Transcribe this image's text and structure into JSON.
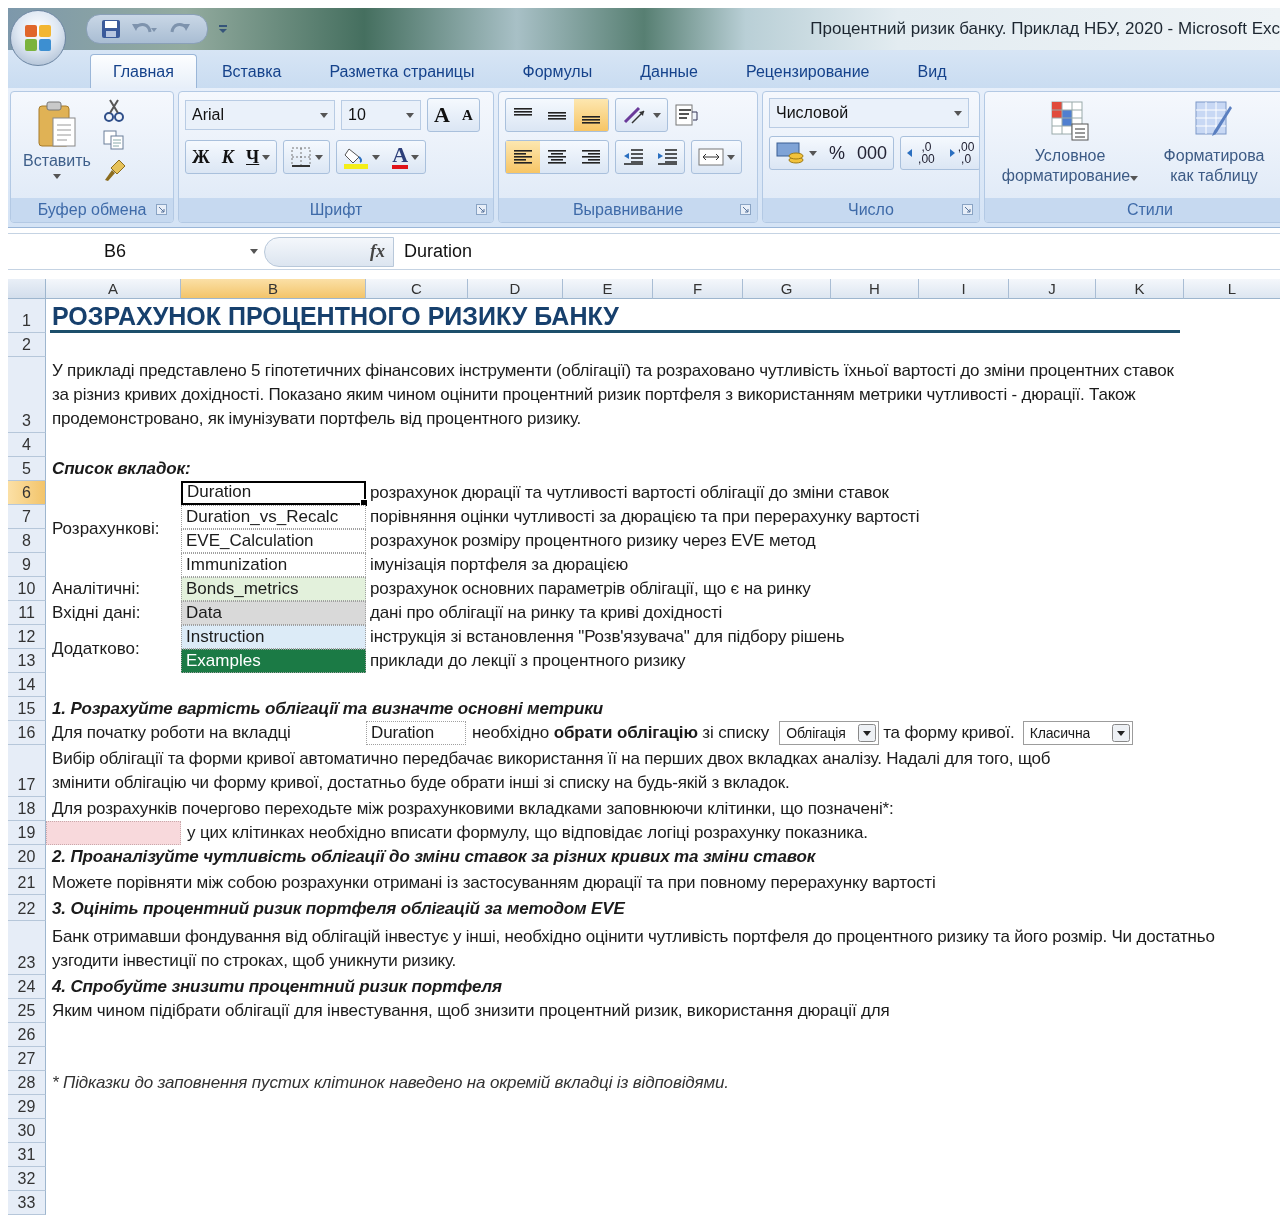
{
  "window": {
    "title": "Процентний ризик банку. Приклад НБУ, 2020 - Microsoft Exc"
  },
  "ribbon_tabs": [
    {
      "label": "Главная",
      "selected": true
    },
    {
      "label": "Вставка",
      "selected": false
    },
    {
      "label": "Разметка страницы",
      "selected": false
    },
    {
      "label": "Формулы",
      "selected": false
    },
    {
      "label": "Данные",
      "selected": false
    },
    {
      "label": "Рецензирование",
      "selected": false
    },
    {
      "label": "Вид",
      "selected": false
    }
  ],
  "ribbon": {
    "clipboard": {
      "paste": "Вставить",
      "group": "Буфер обмена"
    },
    "font": {
      "name": "Arial",
      "size": "10",
      "grow": "A",
      "shrink": "A",
      "bold": "Ж",
      "italic": "К",
      "underline": "Ч",
      "color_button": "A",
      "group": "Шрифт"
    },
    "alignment": {
      "vertical": [
        {
          "selected": false
        },
        {
          "selected": false
        },
        {
          "selected": true
        }
      ],
      "horizontal": [
        {
          "selected": true
        },
        {
          "selected": false
        },
        {
          "selected": false
        }
      ],
      "group": "Выравнивание"
    },
    "number": {
      "format": "Числовой",
      "percent": "%",
      "thousands": "000",
      "decimals": [
        {
          "top": ",0",
          "bottom": ",00"
        },
        {
          "top": ",00",
          "bottom": ",0"
        }
      ],
      "group": "Число"
    },
    "styles": {
      "conditional": "Условное форматирование",
      "table": "Форматирова как таблицу",
      "group": "Стили"
    }
  },
  "formula_bar": {
    "cell": "B6",
    "fx": "fx",
    "value": "Duration"
  },
  "columns": [
    {
      "label": "A",
      "selected": false
    },
    {
      "label": "B",
      "selected": true
    },
    {
      "label": "C",
      "selected": false
    },
    {
      "label": "D",
      "selected": false
    },
    {
      "label": "E",
      "selected": false
    },
    {
      "label": "F",
      "selected": false
    },
    {
      "label": "G",
      "selected": false
    },
    {
      "label": "H",
      "selected": false
    },
    {
      "label": "I",
      "selected": false
    },
    {
      "label": "J",
      "selected": false
    },
    {
      "label": "K",
      "selected": false
    },
    {
      "label": "L",
      "selected": false
    }
  ],
  "rows": [
    {
      "label": "1",
      "selected": false
    },
    {
      "label": "2",
      "selected": false
    },
    {
      "label": "3",
      "selected": false
    },
    {
      "label": "4",
      "selected": false
    },
    {
      "label": "5",
      "selected": false
    },
    {
      "label": "6",
      "selected": true
    },
    {
      "label": "7",
      "selected": false
    },
    {
      "label": "8",
      "selected": false
    },
    {
      "label": "9",
      "selected": false
    },
    {
      "label": "10",
      "selected": false
    },
    {
      "label": "11",
      "selected": false
    },
    {
      "label": "12",
      "selected": false
    },
    {
      "label": "13",
      "selected": false
    },
    {
      "label": "14",
      "selected": false
    },
    {
      "label": "15",
      "selected": false
    },
    {
      "label": "16",
      "selected": false
    },
    {
      "label": "17",
      "selected": false
    },
    {
      "label": "18",
      "selected": false
    },
    {
      "label": "19",
      "selected": false
    },
    {
      "label": "20",
      "selected": false
    },
    {
      "label": "21",
      "selected": false
    },
    {
      "label": "22",
      "selected": false
    },
    {
      "label": "23",
      "selected": false
    },
    {
      "label": "24",
      "selected": false
    },
    {
      "label": "25",
      "selected": false
    },
    {
      "label": "26",
      "selected": false
    },
    {
      "label": "27",
      "selected": false
    },
    {
      "label": "28",
      "selected": false
    },
    {
      "label": "29",
      "selected": false
    },
    {
      "label": "30",
      "selected": false
    },
    {
      "label": "31",
      "selected": false
    },
    {
      "label": "32",
      "selected": false
    },
    {
      "label": "33",
      "selected": false
    }
  ],
  "sheet": {
    "title": "РОЗРАХУНОК ПРОЦЕНТНОГО РИЗИКУ БАНКУ",
    "intro": "У прикладі представлено 5 гіпотетичних фінансових інструменти (облігації) та розраховано чутливість їхньої вартості до зміни процентних ставок за різниз кривих дохідності. Показано яким чином оцінити процентний ризик портфеля з використанням метрики чутливості - дюрації. Також продемонстровано, як імунізувати портфель від процентного ризику.",
    "tabs_heading": "Список вкладок:",
    "tab_groups": [
      {
        "label": "Розрахункові:",
        "items": [
          {
            "name": "Duration",
            "description": "розрахунок дюрації та чутливості вартості облігації до зміни ставок",
            "selected": true,
            "color": "#ffffff"
          },
          {
            "name": "Duration_vs_Recalc",
            "description": "порівняння оцінки чутливості за дюрацією та при перерахунку вартості",
            "selected": false,
            "color": "#ffffff"
          },
          {
            "name": "EVE_Calculation",
            "description": "розрахунок розміру процентного ризику через EVE метод",
            "selected": false,
            "color": "#ffffff"
          },
          {
            "name": "Immunization",
            "description": "імунізація портфеля за дюрацією",
            "selected": false,
            "color": "#ffffff"
          }
        ]
      },
      {
        "label": "Аналітичні:",
        "items": [
          {
            "name": "Bonds_metrics",
            "description": "розрахунок основних параметрів облігації, що є на ринку",
            "selected": false,
            "color": "#e3f1dc"
          }
        ]
      },
      {
        "label": "Вхідні дані:",
        "items": [
          {
            "name": "Data",
            "description": "дані про облігації на ринку та криві дохідності",
            "selected": false,
            "color": "#d9d9d9"
          }
        ]
      },
      {
        "label": "Додатково:",
        "items": [
          {
            "name": "Instruction",
            "description": "інструкція зі встановлення \"Розв'язувача\" для підбору рішень",
            "selected": false,
            "color": "#dcebf7"
          },
          {
            "name": "Examples",
            "description": "приклади до лекції з процентного ризику",
            "selected": false,
            "color": "#1b7a45"
          }
        ]
      }
    ],
    "notes": [
      {
        "kind": "heading",
        "text": "1. Розрахуйте вартість облігації та визначте основні метрики"
      },
      {
        "kind": "start",
        "lead": "Для початку роботи на вкладці",
        "tab_ref": "Duration",
        "middle": "необхідно **обрати облігацію** зі списку",
        "bond": "Облігація",
        "after": "та форму кривої.",
        "curve": "Класична"
      },
      {
        "kind": "text",
        "text": "Вибір облігації та форми кривої автоматично передбачає використання її на перших двох вкладках аналізу. Надалі для того, щоб змінити облігацію чи форму кривої, достатньо буде обрати інші зі списку на будь-якій з вкладок."
      },
      {
        "kind": "text",
        "text": "Для розрахунків почергово переходьте між розрахунковими вкладками заповнюючи клітинки, що позначені*:"
      },
      {
        "kind": "legend",
        "text": "у цих клітинках необхідно вписати формулу, що відповідає логіці розрахунку показника."
      },
      {
        "kind": "heading",
        "text": "2. Проаналізуйте чутливість облігації до зміни ставок за різних кривих та зміни ставок"
      },
      {
        "kind": "text",
        "text": "Можете порівняти між собою розрахунки отримані із застосуванням дюрації та при повному перерахунку вартості"
      },
      {
        "kind": "heading",
        "text": "3. Оцініть процентний ризик портфеля облігацій за методом EVE"
      },
      {
        "kind": "text",
        "text": "Банк отримавши фондування від облігацій інвестує у інші, необхідно оцінити чутливість портфеля до процентного ризику та його розмір. Чи достатньо узгодити інвестиції по строках, щоб уникнути ризику."
      },
      {
        "kind": "heading",
        "text": "4. Спробуйте знизити процентний ризик портфеля"
      },
      {
        "kind": "text",
        "text": "Яким чином підібрати облігації для інвестування, щоб знизити процентний ризик, використання дюрації для"
      },
      {
        "kind": "footnote",
        "text": "* Підказки до заповнення пустих клітинок наведено на окремій вкладці із відповідями."
      }
    ]
  }
}
